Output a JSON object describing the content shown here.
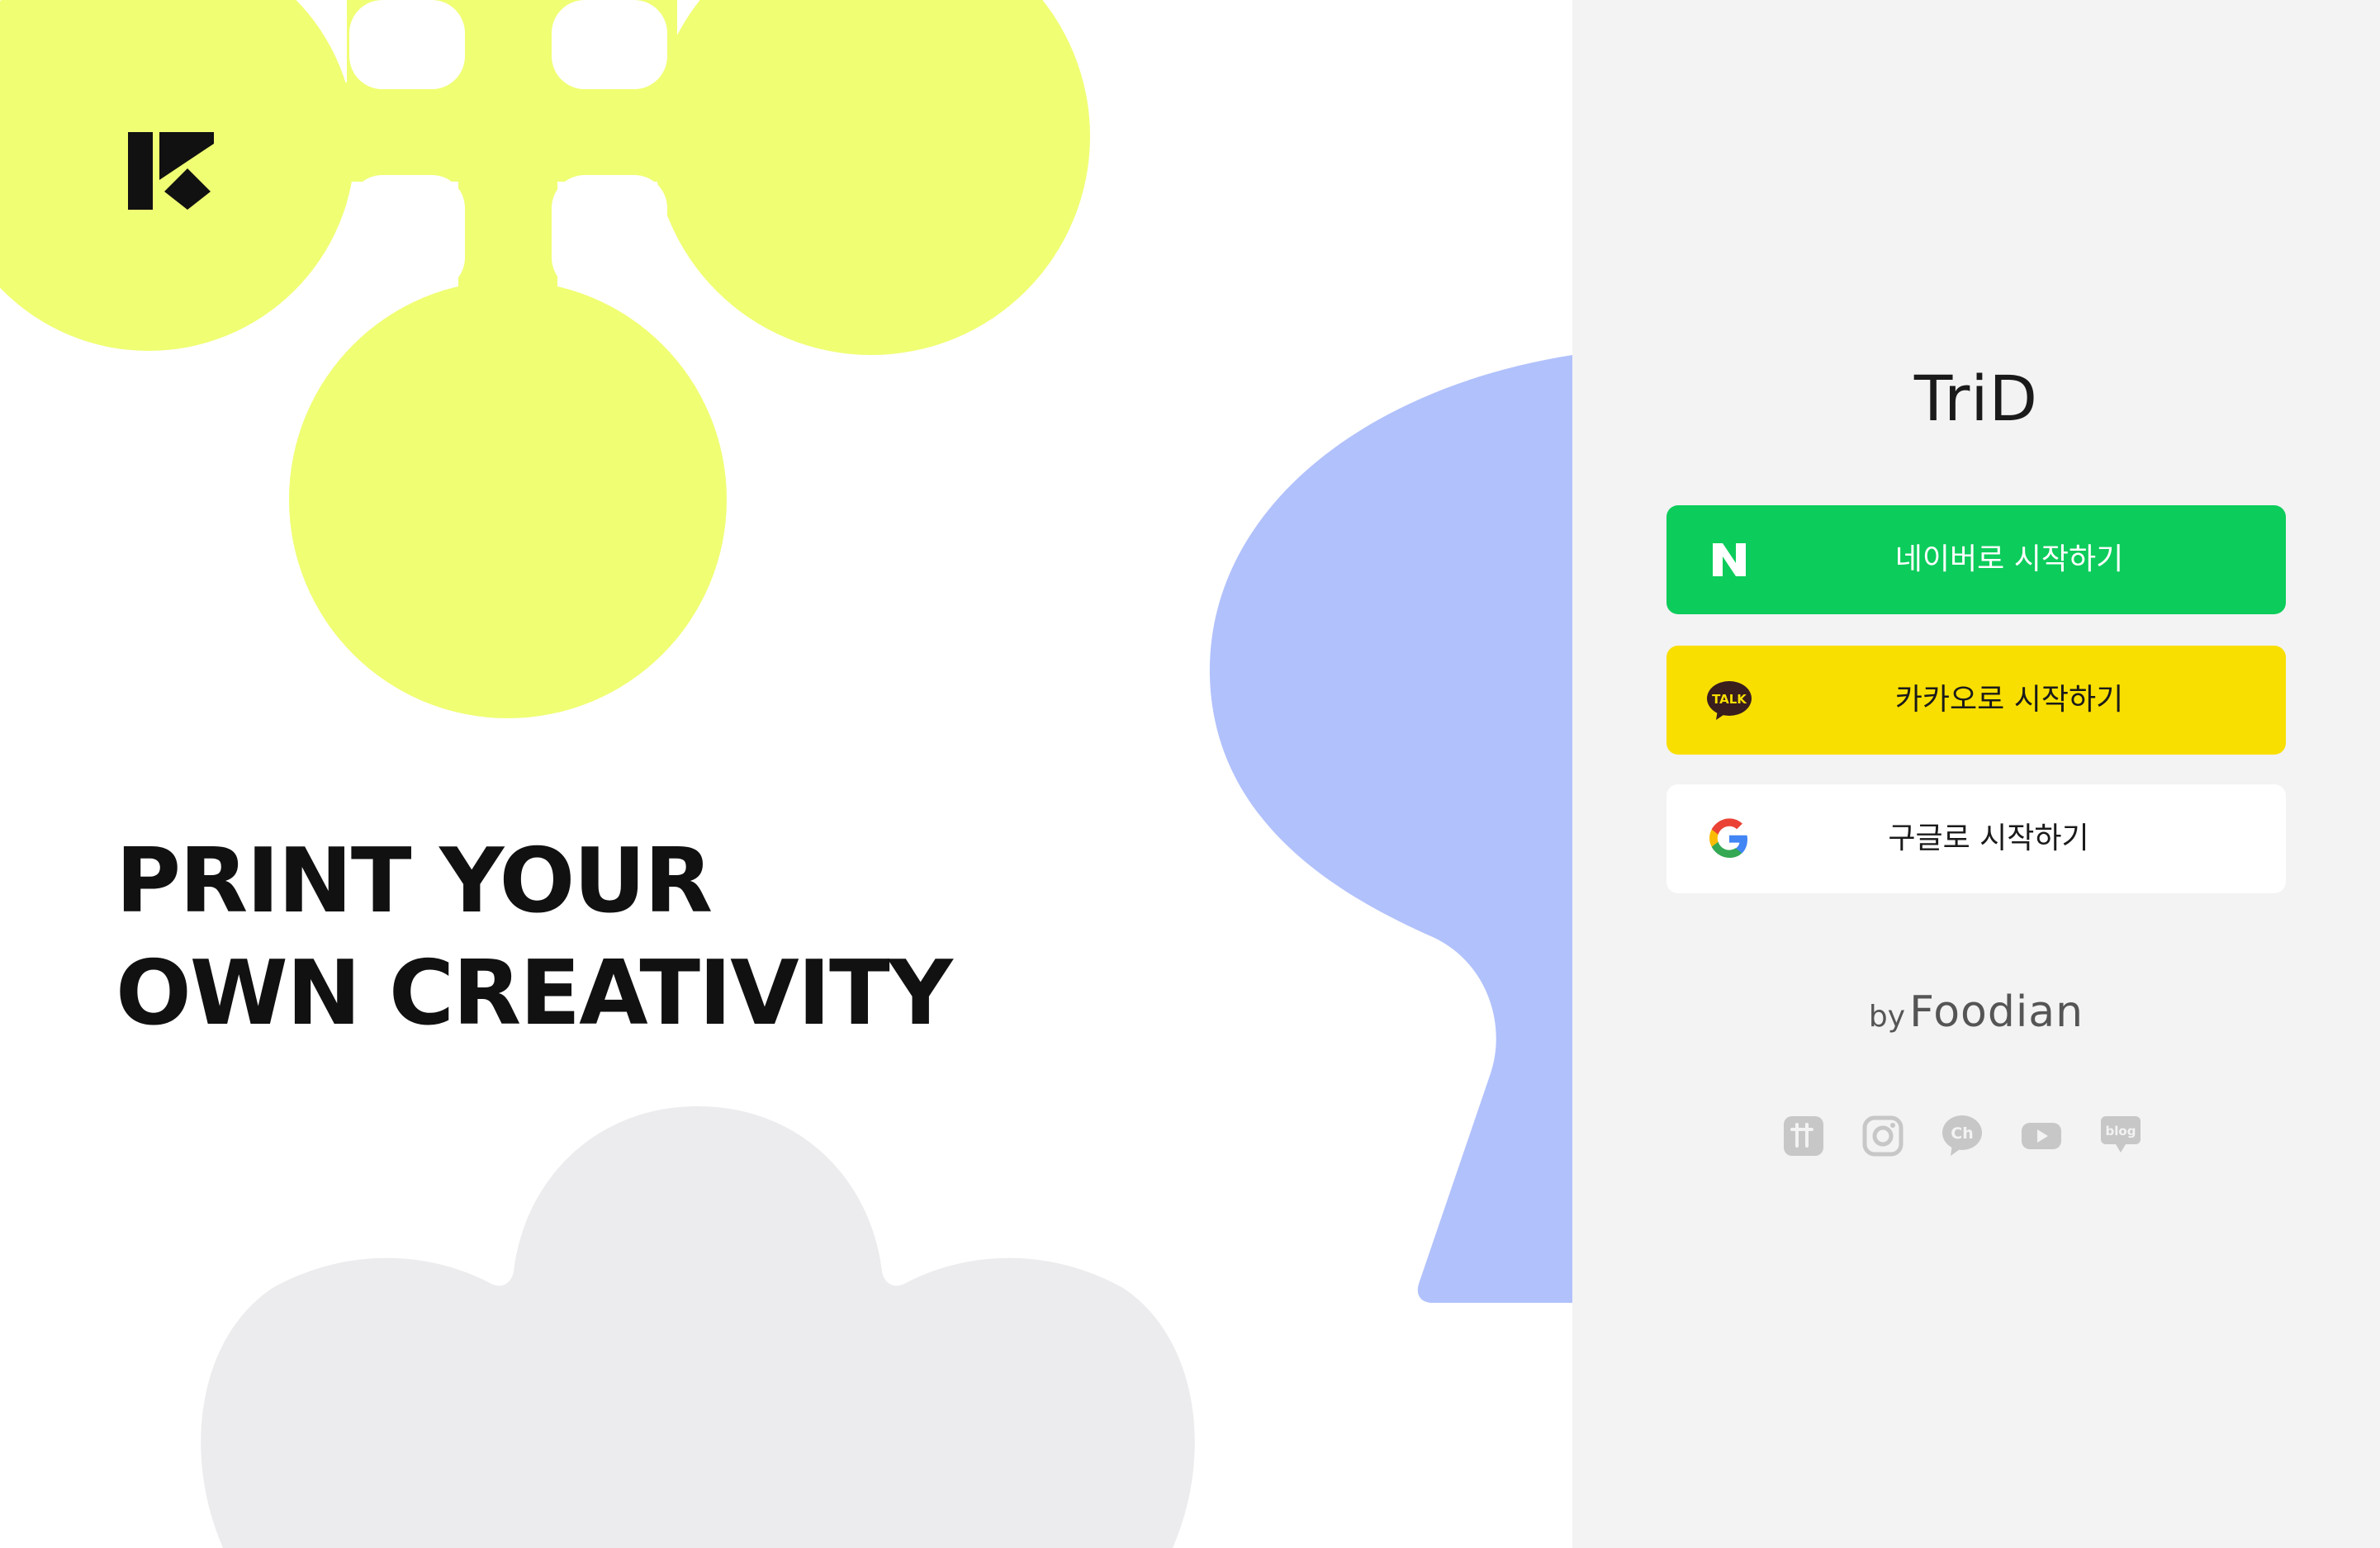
{
  "hero": {
    "headline_line1": "PRINT YOUR",
    "headline_line2": "OWN CREATIVITY"
  },
  "login": {
    "brand": "TriD",
    "buttons": {
      "naver": "네이버로 시작하기",
      "kakao": "카카오로 시작하기",
      "google": "구글로 시작하기"
    },
    "kakao_icon_text": "TALK",
    "by_prefix": "by",
    "by_name": "Foodian"
  },
  "socials": [
    {
      "icon": "tistory-icon"
    },
    {
      "icon": "instagram-icon"
    },
    {
      "icon": "kakao-channel-icon",
      "text": "Ch"
    },
    {
      "icon": "youtube-icon"
    },
    {
      "icon": "blog-icon",
      "text": "blog"
    }
  ],
  "colors": {
    "lime": "#f0fe73",
    "lavender": "#b1c1fc",
    "cloud": "#ececee",
    "naver_green": "#0ccc5b",
    "kakao_yellow": "#f9df00",
    "panel_bg": "#f3f3f3"
  }
}
